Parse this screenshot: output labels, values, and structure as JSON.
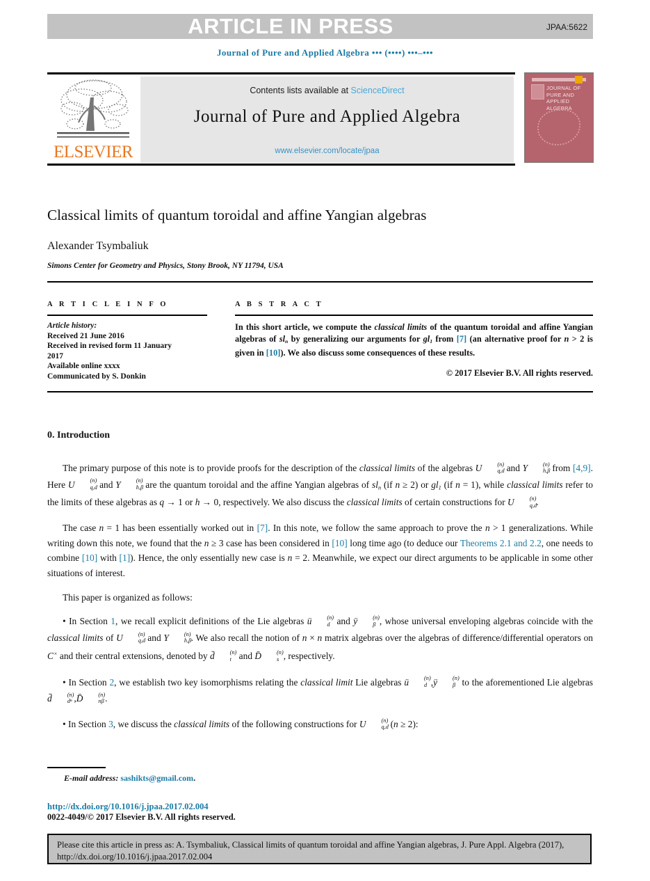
{
  "banner": {
    "text": "ARTICLE IN PRESS",
    "code": "JPAA:5622",
    "bg_color": "#c2c2c2"
  },
  "running_head": {
    "journal_line": "Journal of Pure and Applied Algebra ••• (••••) •••–•••",
    "color": "#1a7ba5"
  },
  "masthead": {
    "publisher_name": "ELSEVIER",
    "publisher_color": "#e87722",
    "contents_prefix": "Contents lists available at ",
    "contents_link": "ScienceDirect",
    "contents_link_color": "#4aa8d8",
    "journal_title": "Journal of Pure and Applied Algebra",
    "journal_url": "www.elsevier.com/locate/jpaa",
    "journal_url_color": "#3a92c4",
    "cover": {
      "line1": "JOURNAL OF",
      "line2": "PURE AND",
      "line3": "APPLIED ALGEBRA",
      "bg_color": "#b5636c"
    }
  },
  "article": {
    "title": "Classical limits of quantum toroidal and affine Yangian algebras",
    "author": "Alexander Tsymbaliuk",
    "affiliation": "Simons Center for Geometry and Physics, Stony Brook, NY 11794, USA"
  },
  "info": {
    "heading": "A R T I C L E   I N F O",
    "history_label": "Article history:",
    "lines": [
      "Received 21 June 2016",
      "Received in revised form 11 January",
      "2017",
      "Available online xxxx",
      "Communicated by S. Donkin"
    ]
  },
  "abstract": {
    "heading": "A B S T R A C T",
    "copyright": "© 2017 Elsevier B.V. All rights reserved."
  },
  "introduction": {
    "heading": "0. Introduction",
    "organized_line": "This paper is organized as follows:"
  },
  "footnote": {
    "email_label": "E-mail address:",
    "email": "sashikts@gmail.com",
    "email_suffix": ".",
    "doi_url": "http://dx.doi.org/10.1016/j.jpaa.2017.02.004",
    "issn_line": "0022-4049/© 2017 Elsevier B.V. All rights reserved."
  },
  "citation_box": {
    "line1": "Please cite this article in press as: A. Tsymbaliuk, Classical limits of quantum toroidal and affine Yangian algebras, J. Pure",
    "line2": "Appl. Algebra (2017), http://dx.doi.org/10.1016/j.jpaa.2017.02.004",
    "bg_color": "#c2c2c2"
  },
  "links": {
    "citation_color": "#1a7ba5"
  }
}
